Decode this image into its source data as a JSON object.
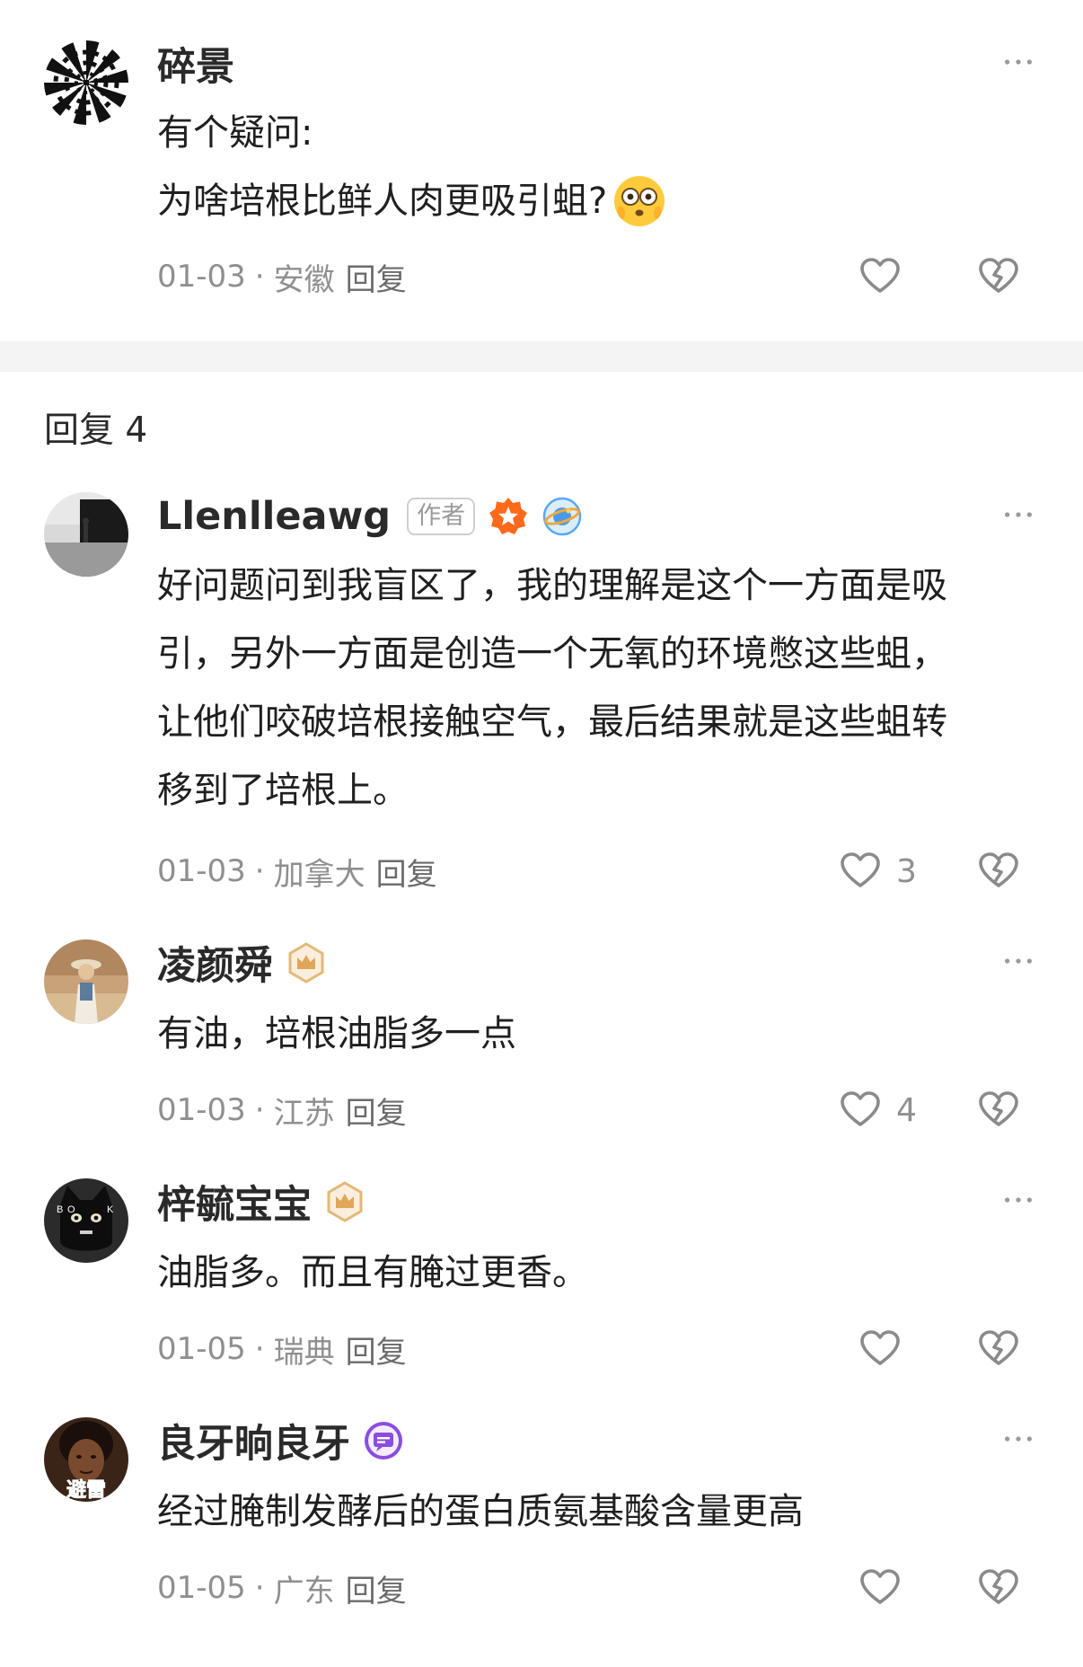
{
  "main_comment": {
    "name": "碎景",
    "lines": [
      "有个疑问:",
      "为啥培根比鲜人肉更吸引蛆?"
    ],
    "emoji": "flushed-face-emoji",
    "date": "01-03",
    "location": "安徽",
    "reply_label": "回复"
  },
  "replies_header": {
    "label": "回复",
    "count": "4"
  },
  "replies": [
    {
      "name": "Llenlleawg",
      "author_tag": "作者",
      "badges": [
        "orange-star-badge",
        "planet-badge"
      ],
      "lines": [
        "好问题问到我盲区了，我的理解是这个一方面是吸",
        "引，另外一方面是创造一个无氧的环境憋这些蛆，",
        "让他们咬破培根接触空气，最后结果就是这些蛆转",
        "移到了培根上。"
      ],
      "date": "01-03",
      "location": "加拿大",
      "reply_label": "回复",
      "likes": "3"
    },
    {
      "name": "凌颜舜",
      "badges": [
        "crown-badge"
      ],
      "lines": [
        "有油，培根油脂多一点"
      ],
      "date": "01-03",
      "location": "江苏",
      "reply_label": "回复",
      "likes": "4"
    },
    {
      "name": "梓毓宝宝",
      "badges": [
        "crown-badge"
      ],
      "lines": [
        "油脂多。而且有腌过更香。"
      ],
      "date": "01-05",
      "location": "瑞典",
      "reply_label": "回复",
      "likes": ""
    },
    {
      "name": "良牙晌良牙",
      "badges": [
        "chat-badge"
      ],
      "avatar_text": "避雷",
      "lines": [
        "经过腌制发酵后的蛋白质氨基酸含量更高"
      ],
      "date": "01-05",
      "location": "广东",
      "reply_label": "回复",
      "likes": ""
    }
  ],
  "colors": {
    "text": "#1f1f1f",
    "meta": "#8f8f8f",
    "divider": "#f4f4f4",
    "icon": "#8a8a8a"
  },
  "icons": {
    "more": "more-dots-icon",
    "like": "heart-icon",
    "dislike": "broken-heart-icon"
  }
}
